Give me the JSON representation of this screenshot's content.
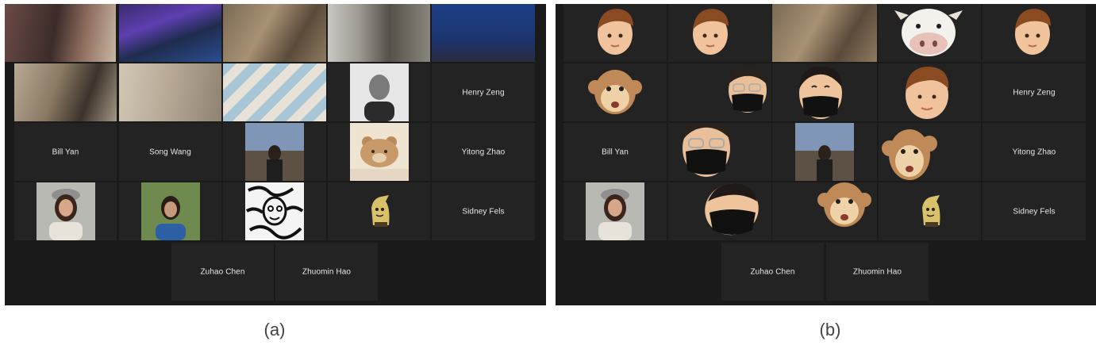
{
  "captions": {
    "a": "(a)",
    "b": "(b)"
  },
  "participants": {
    "henry": "Henry Zeng",
    "bill": "Bill Yan",
    "song": "Song Wang",
    "yitong": "Yitong Zhao",
    "sidney": "Sidney Fels",
    "zuhao": "Zuhao Chen",
    "zhuomin": "Zhuomin Hao"
  },
  "colors": {
    "gallery_background": "#1a1a1a",
    "tile_background": "#232323",
    "active_speaker_border": "#b6c879",
    "name_text": "#e8e8e8"
  },
  "icons": {
    "avatar_human": "memoji-face-icon",
    "avatar_monkey": "monkey-avatar-icon",
    "avatar_cow": "cow-avatar-icon",
    "profile_bear": "bear-drawing-icon",
    "profile_mimikyu": "mimikyu-sticker-icon"
  }
}
